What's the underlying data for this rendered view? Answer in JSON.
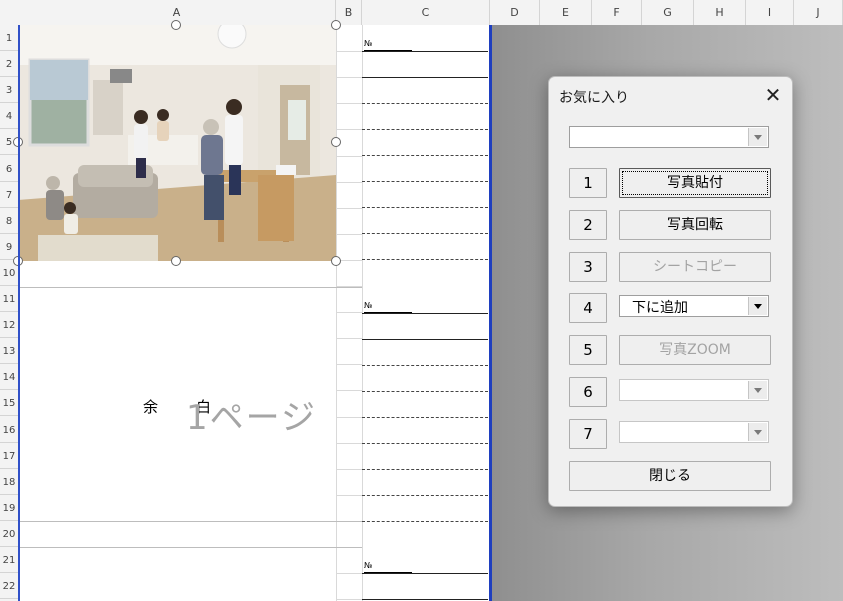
{
  "columns": [
    "A",
    "B",
    "C",
    "D",
    "E",
    "F",
    "G",
    "H",
    "I",
    "J"
  ],
  "rows": [
    "1",
    "2",
    "3",
    "4",
    "5",
    "6",
    "7",
    "8",
    "9",
    "10",
    "11",
    "12",
    "13",
    "14",
    "15",
    "16",
    "17",
    "18",
    "19",
    "20",
    "21",
    "22"
  ],
  "sheet": {
    "no_label": "№",
    "blank_text": [
      "余",
      "白"
    ],
    "page_label": "1ページ"
  },
  "dialog": {
    "title": "お気に入り",
    "close_label": "✕",
    "top_combo_value": "",
    "number_buttons": [
      "1",
      "2",
      "3",
      "4",
      "5",
      "6",
      "7"
    ],
    "photo_paste": "写真貼付",
    "photo_rotate": "写真回転",
    "sheet_copy": "シートコピー",
    "add_below": "下に追加",
    "photo_zoom": "写真ZOOM",
    "close_button": "閉じる"
  },
  "colors": {
    "print_border": "#1f3fbf",
    "dialog_bg": "#f0f0f0"
  }
}
